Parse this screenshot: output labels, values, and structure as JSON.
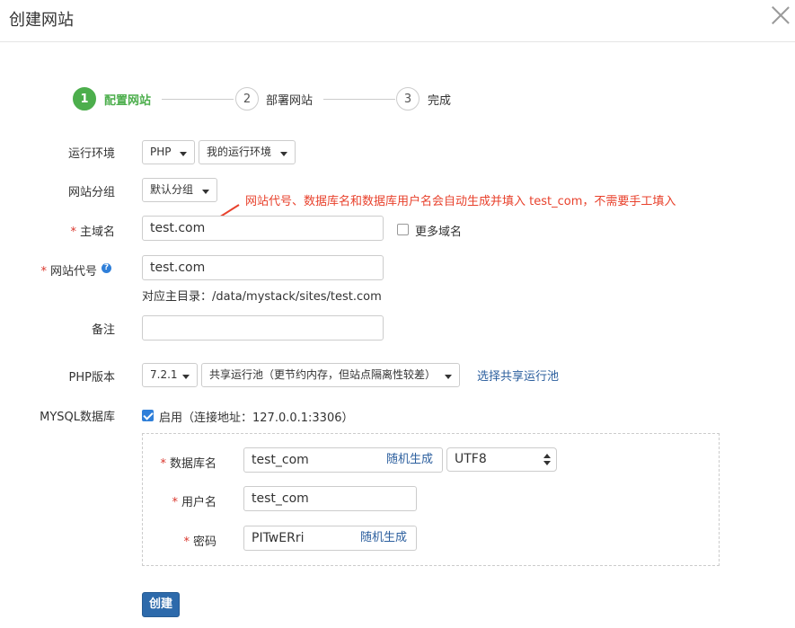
{
  "dialog": {
    "title": "创建网站"
  },
  "steps": [
    {
      "num": "1",
      "label": "配置网站"
    },
    {
      "num": "2",
      "label": "部署网站"
    },
    {
      "num": "3",
      "label": "完成"
    }
  ],
  "form": {
    "runtime_label": "运行环境",
    "runtime_value": "PHP",
    "runtime_env_value": "我的运行环境",
    "group_label": "网站分组",
    "group_value": "默认分组",
    "annotation": "网站代号、数据库名和数据库用户名会自动生成并填入 test_com，不需要手工填入",
    "required_mark": "*",
    "domain_label": "主域名",
    "domain_value": "test.com",
    "more_domains_label": "更多域名",
    "code_label": "网站代号",
    "code_value": "test.com",
    "code_help": "?",
    "root_hint": "对应主目录：/data/mystack/sites/test.com",
    "note_label": "备注",
    "note_value": "",
    "php_label": "PHP版本",
    "php_version": "7.2.1",
    "pool_value": "共享运行池（更节约内存，但站点隔离性较差）",
    "pool_link": "选择共享运行池",
    "mysql_label": "MYSQL数据库",
    "mysql_enable": "启用（连接地址：127.0.0.1:3306）"
  },
  "db": {
    "name_label": "数据库名",
    "name_value": "test_com",
    "random_label": "随机生成",
    "charset": "UTF8",
    "user_label": "用户名",
    "user_value": "test_com",
    "password_label": "密码",
    "password_value": "PITwERri"
  },
  "actions": {
    "create": "创建"
  },
  "colors": {
    "active_step": "#4cae4c",
    "primary": "#2d6aab",
    "annotation": "#e8412c",
    "required": "#d9362c"
  }
}
